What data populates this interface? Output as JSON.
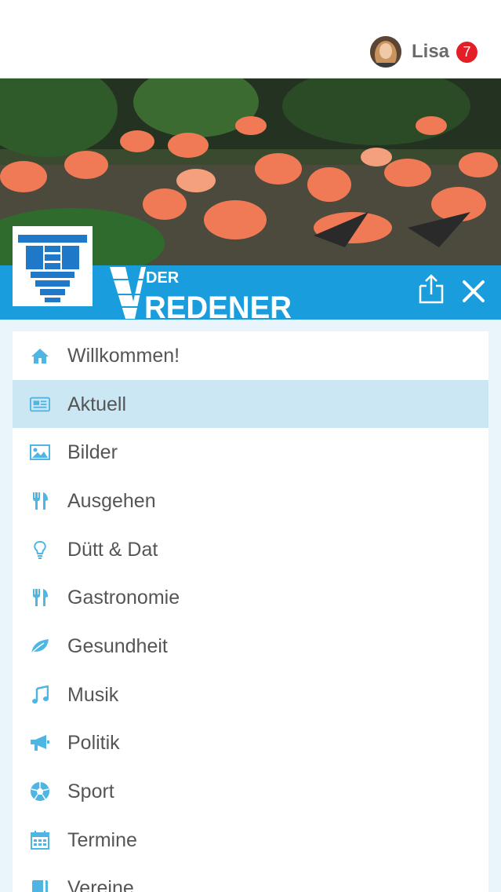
{
  "colors": {
    "brand_blue": "#1a9ddc",
    "logo_blue": "#1f78c8",
    "icon_blue": "#4fb6e4",
    "badge_red": "#e31e24",
    "active_row": "#cce7f4"
  },
  "user": {
    "name": "Lisa",
    "notification_count": "7"
  },
  "brand": {
    "wordmark_small": "DER",
    "wordmark_large": "REDENER",
    "logo_letter": "V"
  },
  "hero": {
    "subject": "flamingos"
  },
  "toolbar": {
    "share_icon": "share-icon",
    "close_icon": "close-icon"
  },
  "menu": {
    "active_index": 1,
    "items": [
      {
        "label": "Willkommen!",
        "icon": "home-icon"
      },
      {
        "label": "Aktuell",
        "icon": "newspaper-icon"
      },
      {
        "label": "Bilder",
        "icon": "image-icon"
      },
      {
        "label": "Ausgehen",
        "icon": "cutlery-icon"
      },
      {
        "label": "Dütt & Dat",
        "icon": "lightbulb-icon"
      },
      {
        "label": "Gastronomie",
        "icon": "cutlery-icon"
      },
      {
        "label": "Gesundheit",
        "icon": "leaf-icon"
      },
      {
        "label": "Musik",
        "icon": "music-icon"
      },
      {
        "label": "Politik",
        "icon": "megaphone-icon"
      },
      {
        "label": "Sport",
        "icon": "soccer-ball-icon"
      },
      {
        "label": "Termine",
        "icon": "calendar-icon"
      },
      {
        "label": "Vereine",
        "icon": "book-icon"
      }
    ]
  }
}
